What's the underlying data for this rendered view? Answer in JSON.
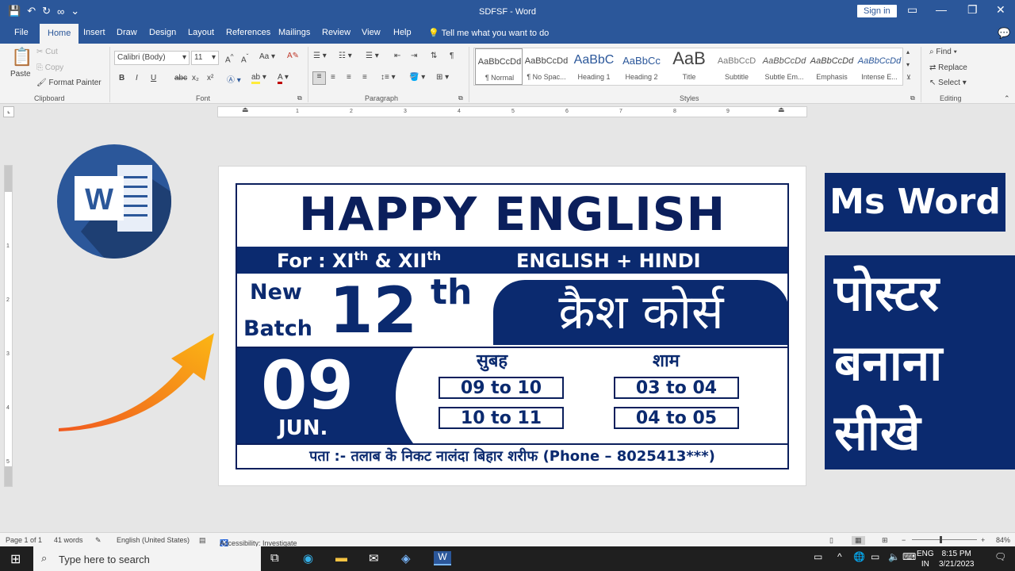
{
  "window": {
    "title": "SDFSF  -  Word",
    "signin": "Sign in"
  },
  "qat": {
    "save": "💾",
    "undo": "↶",
    "redo": "↻",
    "more": "∞",
    "customize": "⌄"
  },
  "tabs": [
    "File",
    "Home",
    "Insert",
    "Draw",
    "Design",
    "Layout",
    "References",
    "Mailings",
    "Review",
    "View",
    "Help"
  ],
  "tellme": "Tell me what you want to do",
  "clipboard": {
    "paste": "Paste",
    "cut": "Cut",
    "copy": "Copy",
    "format_painter": "Format Painter",
    "label": "Clipboard"
  },
  "font": {
    "name": "Calibri (Body)",
    "size": "11",
    "label": "Font",
    "bold": "B",
    "italic": "I",
    "underline": "U",
    "strike": "abc",
    "sub": "x₂",
    "sup": "x²"
  },
  "paragraph": {
    "label": "Paragraph"
  },
  "styles": {
    "label": "Styles",
    "items": [
      {
        "sample": "AaBbCcDd",
        "name": "¶ Normal"
      },
      {
        "sample": "AaBbCcDd",
        "name": "¶ No Spac..."
      },
      {
        "sample": "AaBbC",
        "name": "Heading 1"
      },
      {
        "sample": "AaBbCc",
        "name": "Heading 2"
      },
      {
        "sample": "AaB",
        "name": "Title"
      },
      {
        "sample": "AaBbCcD",
        "name": "Subtitle"
      },
      {
        "sample": "AaBbCcDd",
        "name": "Subtle Em..."
      },
      {
        "sample": "AaBbCcDd",
        "name": "Emphasis"
      },
      {
        "sample": "AaBbCcDd",
        "name": "Intense E..."
      }
    ]
  },
  "editing": {
    "find": "Find",
    "replace": "Replace",
    "select": "Select",
    "label": "Editing"
  },
  "ruler": {
    "marks": [
      "1",
      "2",
      "3",
      "4",
      "5",
      "6",
      "7",
      "8",
      "9"
    ],
    "vmarks": [
      "1",
      "2",
      "3",
      "4",
      "5"
    ]
  },
  "poster": {
    "title": "HAPPY ENGLISH",
    "for_prefix": "For : XI",
    "th": "th",
    "and": " & XII",
    "subjects": "ENGLISH + HINDI",
    "new": "New",
    "batch": "Batch",
    "grade": "12",
    "grade_suffix": "th",
    "crash": "क्रैश  कोर्स",
    "date": "09",
    "month": "JUN.",
    "morning": "सुबह",
    "evening": "शाम",
    "slots": [
      "09 to 10",
      "10 to 11",
      "03 to 04",
      "04 to 05"
    ],
    "address": "पता :- तलाब के निकट नालंदा बिहार शरीफ (Phone – 8025413***)"
  },
  "overlay": {
    "ms_word": "Ms Word",
    "hindi_lines": [
      "पोस्टर",
      "बनाना",
      "सीखे"
    ],
    "logo_letter": "W"
  },
  "status": {
    "page": "Page 1 of 1",
    "words": "41 words",
    "language": "English (United States)",
    "accessibility": "Accessibility: Investigate",
    "zoom": "84%"
  },
  "taskbar": {
    "search": "Type here to search",
    "lang1": "ENG",
    "lang2": "IN",
    "time": "8:15 PM",
    "date": "3/21/2023"
  },
  "colors": {
    "brand": "#2b579a",
    "poster_navy": "#0b2a6f",
    "arrow_start": "#f0591f",
    "arrow_end": "#fbb614"
  }
}
